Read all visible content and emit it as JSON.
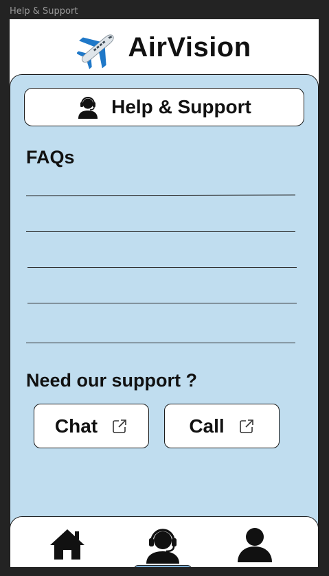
{
  "window": {
    "title": "Help & Support"
  },
  "header": {
    "app_name": "AirVision",
    "logo_icon": "airplane-icon"
  },
  "title_bar": {
    "label": "Help & Support",
    "icon": "support-agent-icon"
  },
  "faq": {
    "heading": "FAQs",
    "items": [
      "",
      "",
      "",
      "",
      ""
    ]
  },
  "support": {
    "heading": "Need our support ?",
    "chat_label": "Chat",
    "call_label": "Call",
    "external_icon": "external-link-icon"
  },
  "nav": {
    "items": [
      {
        "name": "home",
        "icon": "home-icon"
      },
      {
        "name": "support",
        "icon": "support-agent-icon",
        "active": true
      },
      {
        "name": "profile",
        "icon": "user-icon"
      }
    ]
  },
  "colors": {
    "panel": "#c0ddef",
    "frame": "#232323",
    "accent": "#7fb2d8",
    "plane_blue": "#1f78c8"
  }
}
